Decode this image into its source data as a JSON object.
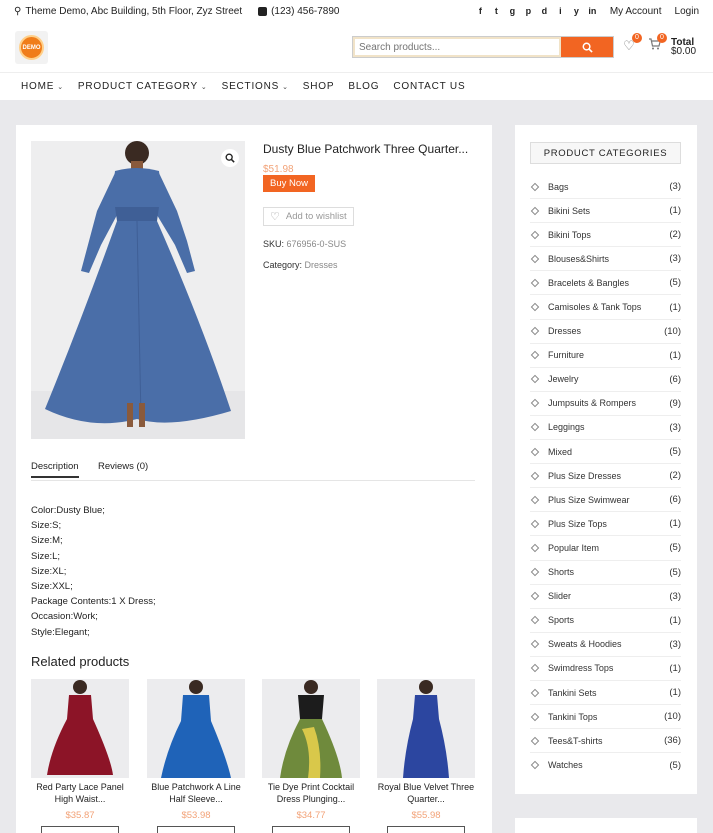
{
  "topbar": {
    "address": "Theme Demo, Abc Building, 5th Floor, Zyz Street",
    "phone": "(123) 456-7890",
    "social": [
      "f",
      "t",
      "g",
      "p",
      "d",
      "i",
      "y",
      "in"
    ],
    "account_label": "My Account",
    "login_label": "Login"
  },
  "header": {
    "logo_text": "DEMO",
    "search_placeholder": "Search products...",
    "wishlist_count": "0",
    "cart_count": "0",
    "total_label": "Total",
    "total_value": "$0.00"
  },
  "nav": [
    {
      "label": "HOME",
      "dropdown": true
    },
    {
      "label": "PRODUCT CATEGORY",
      "dropdown": true
    },
    {
      "label": "SECTIONS",
      "dropdown": true
    },
    {
      "label": "SHOP",
      "dropdown": false
    },
    {
      "label": "BLOG",
      "dropdown": false
    },
    {
      "label": "CONTACT US",
      "dropdown": false
    }
  ],
  "product": {
    "title": "Dusty Blue Patchwork Three Quarter...",
    "price": "$51.98",
    "buy_label": "Buy Now",
    "wishlist_label": "Add to wishlist",
    "sku_label": "SKU:",
    "sku_value": "676956-0-SUS",
    "category_label": "Category:",
    "category_value": "Dresses"
  },
  "tabs": [
    {
      "label": "Description",
      "active": true
    },
    {
      "label": "Reviews (0)",
      "active": false
    }
  ],
  "description": [
    "Color:Dusty Blue;",
    "Size:S;",
    "Size:M;",
    "Size:L;",
    "Size:XL;",
    "Size:XXL;",
    "Package Contents:1 X Dress;",
    "Occasion:Work;",
    "Style:Elegant;"
  ],
  "related": {
    "title": "Related products",
    "items": [
      {
        "name1": "Red Party Lace Panel",
        "name2": "High Waist...",
        "price": "$35.87",
        "color": "#8c1427"
      },
      {
        "name1": "Blue Patchwork A Line",
        "name2": "Half Sleeve...",
        "price": "$53.98",
        "color": "#1f63b8"
      },
      {
        "name1": "Tie Dye Print Cocktail",
        "name2": "Dress Plunging...",
        "price": "$34.77",
        "color": "#6f8a3c"
      },
      {
        "name1": "Royal Blue Velvet Three",
        "name2": "Quarter...",
        "price": "$55.98",
        "color": "#2c46a0"
      }
    ]
  },
  "sidebar": {
    "title": "PRODUCT CATEGORIES",
    "categories": [
      {
        "name": "Bags",
        "count": "(3)"
      },
      {
        "name": "Bikini Sets",
        "count": "(1)"
      },
      {
        "name": "Bikini Tops",
        "count": "(2)"
      },
      {
        "name": "Blouses&Shirts",
        "count": "(3)"
      },
      {
        "name": "Bracelets & Bangles",
        "count": "(5)"
      },
      {
        "name": "Camisoles & Tank Tops",
        "count": "(1)"
      },
      {
        "name": "Dresses",
        "count": "(10)"
      },
      {
        "name": "Furniture",
        "count": "(1)"
      },
      {
        "name": "Jewelry",
        "count": "(6)"
      },
      {
        "name": "Jumpsuits & Rompers",
        "count": "(9)"
      },
      {
        "name": "Leggings",
        "count": "(3)"
      },
      {
        "name": "Mixed",
        "count": "(5)"
      },
      {
        "name": "Plus Size Dresses",
        "count": "(2)"
      },
      {
        "name": "Plus Size Swimwear",
        "count": "(6)"
      },
      {
        "name": "Plus Size Tops",
        "count": "(1)"
      },
      {
        "name": "Popular Item",
        "count": "(5)"
      },
      {
        "name": "Shorts",
        "count": "(5)"
      },
      {
        "name": "Slider",
        "count": "(3)"
      },
      {
        "name": "Sports",
        "count": "(1)"
      },
      {
        "name": "Sweats & Hoodies",
        "count": "(3)"
      },
      {
        "name": "Swimdress Tops",
        "count": "(1)"
      },
      {
        "name": "Tankini Sets",
        "count": "(1)"
      },
      {
        "name": "Tankini Tops",
        "count": "(10)"
      },
      {
        "name": "Tees&T-shirts",
        "count": "(36)"
      },
      {
        "name": "Watches",
        "count": "(5)"
      }
    ]
  },
  "colors": {
    "accent": "#f26522",
    "price": "#f2a277",
    "dress": "#4a6ea8"
  }
}
